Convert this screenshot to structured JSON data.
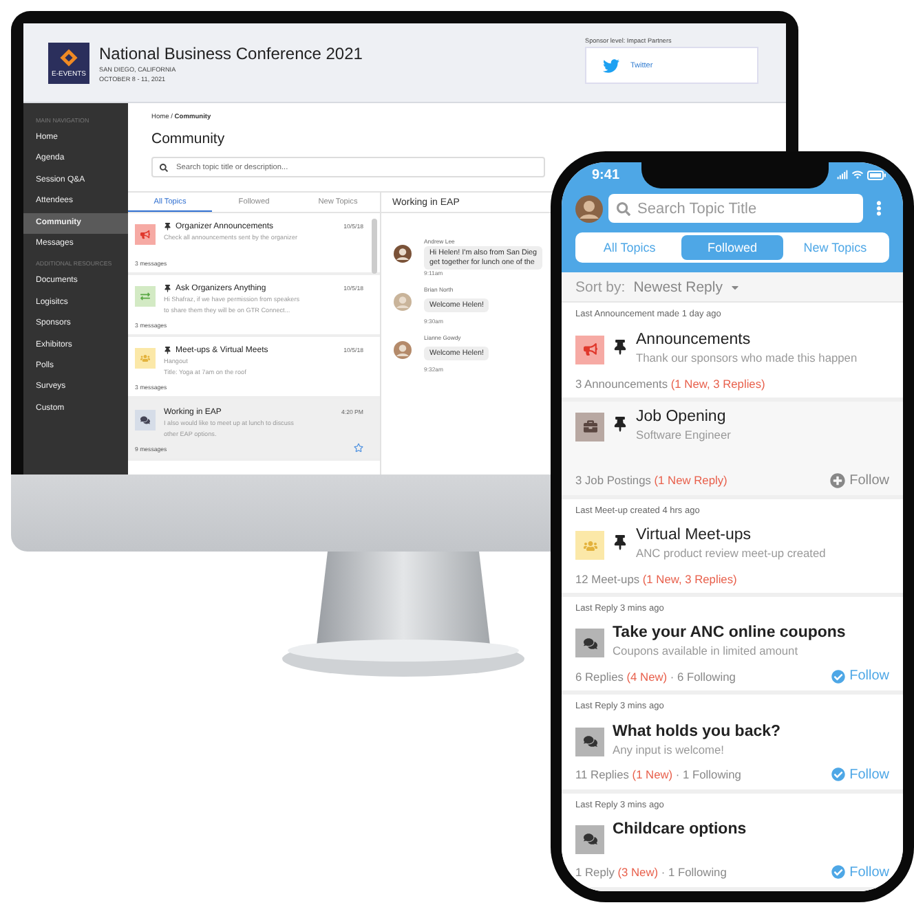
{
  "desktop": {
    "event": {
      "logo_text": "E-EVENTS",
      "title": "National Business Conference 2021",
      "location": "SAN DIEGO, CALIFORNIA",
      "dates": "OCTOBER 8 - 11, 2021"
    },
    "sponsor": {
      "label": "Sponsor level: Impact Partners",
      "name": "Twitter"
    },
    "sidebar": {
      "sections": [
        {
          "heading": "MAIN NAVIGATION",
          "items": [
            {
              "label": "Home",
              "selected": false
            },
            {
              "label": "Agenda",
              "selected": false
            },
            {
              "label": "Session Q&A",
              "selected": false
            },
            {
              "label": "Attendees",
              "selected": false
            },
            {
              "label": "Community",
              "selected": true
            },
            {
              "label": "Messages",
              "selected": false
            }
          ]
        },
        {
          "heading": "ADDITIONAL RESOURCES",
          "items": [
            {
              "label": "Documents",
              "selected": false
            },
            {
              "label": "Logisitcs",
              "selected": false
            },
            {
              "label": "Sponsors",
              "selected": false
            },
            {
              "label": "Exhibitors",
              "selected": false
            },
            {
              "label": "Polls",
              "selected": false
            },
            {
              "label": "Surveys",
              "selected": false
            },
            {
              "label": "Custom",
              "selected": false
            }
          ]
        }
      ]
    },
    "breadcrumb": "Home / **Community**",
    "page_title": "Community",
    "search": {
      "placeholder": "Search topic title or description..."
    },
    "tabs": [
      {
        "label": "All Topics",
        "selected": true
      },
      {
        "label": "Followed",
        "selected": false
      },
      {
        "label": "New Topics",
        "selected": false
      }
    ],
    "topics": [
      {
        "kind": "announcement",
        "pinned": true,
        "title": "Organizer Announcements",
        "preview": [
          "Check all announcements sent by the organizer"
        ],
        "date": "10/5/18",
        "count": "3 messages",
        "selected": false
      },
      {
        "kind": "question",
        "pinned": true,
        "title": "Ask Organizers Anything",
        "preview": [
          "Hi Shafraz, if we have permission from speakers",
          "to share them they will be on GTR Connect..."
        ],
        "date": "10/5/18",
        "count": "3 messages",
        "selected": false
      },
      {
        "kind": "meetup",
        "pinned": true,
        "title": "Meet-ups & Virtual Meets",
        "preview": [
          "Hangout",
          "Title: Yoga at 7am on the roof"
        ],
        "date": "10/5/18",
        "count": "3 messages",
        "selected": false
      },
      {
        "kind": "discussion",
        "pinned": false,
        "title": "Working in EAP",
        "preview": [
          "I also would like to meet up at lunch to discuss",
          "other EAP options."
        ],
        "date": "4:20 PM",
        "count": "9 messages",
        "selected": true,
        "starred": false
      }
    ],
    "conversation": {
      "title": "Working in EAP",
      "messages": [
        {
          "author": "Andrew Lee",
          "lines": [
            "Hi Helen! I'm also from San Dieg",
            "get together for lunch one of the"
          ],
          "time": "9:11am"
        },
        {
          "author": "Brian North",
          "lines": [
            "Welcome Helen!"
          ],
          "time": "9:30am"
        },
        {
          "author": "Lianne Gowdy",
          "lines": [
            "Welcome Helen!"
          ],
          "time": "9:32am"
        }
      ]
    }
  },
  "phone": {
    "status": {
      "time": "9:41"
    },
    "search": {
      "placeholder": "Search Topic Title"
    },
    "tabs": [
      {
        "label": "All Topics",
        "selected": false
      },
      {
        "label": "Followed",
        "selected": true
      },
      {
        "label": "New Topics",
        "selected": false
      }
    ],
    "sort": {
      "label": "Sort by:",
      "value": "Newest Reply"
    },
    "topics": [
      {
        "kind": "announcement",
        "pinned": true,
        "highlighted": false,
        "meta": "Last Announcement made 1 day ago",
        "title": "Announcements",
        "subtitle": "Thank our sponsors who made this happen",
        "count": "3 Announcements",
        "new": "(1 New, 3 Replies)"
      },
      {
        "kind": "job",
        "pinned": true,
        "highlighted": true,
        "title": "Job Opening",
        "subtitle": "Software Engineer",
        "count": "3 Job Postings",
        "new": "(1 New Reply)",
        "follow": {
          "label": "Follow",
          "followed": false
        }
      },
      {
        "kind": "meetup",
        "pinned": true,
        "highlighted": false,
        "meta": "Last Meet-up created 4 hrs ago",
        "title": "Virtual Meet-ups",
        "subtitle": "ANC product review meet-up created",
        "count": "12 Meet-ups",
        "new": "(1 New, 3 Replies)"
      },
      {
        "kind": "discussion",
        "pinned": false,
        "highlighted": false,
        "meta": "Last Reply 3 mins ago",
        "title": "Take your ANC online coupons",
        "subtitle": "Coupons available in limited amount",
        "count": "6 Replies",
        "new": "(4 New)",
        "following": "· 6 Following",
        "follow": {
          "label": "Follow",
          "followed": true
        }
      },
      {
        "kind": "discussion",
        "pinned": false,
        "highlighted": false,
        "meta": "Last Reply 3 mins ago",
        "title": "What holds you back?",
        "subtitle": "Any input is welcome!",
        "count": "11 Replies",
        "new": "(1 New)",
        "following": "· 1 Following",
        "follow": {
          "label": "Follow",
          "followed": true
        }
      },
      {
        "kind": "discussion",
        "pinned": false,
        "highlighted": false,
        "meta": "Last Reply 3 mins ago",
        "title": "Childcare options",
        "count": "1 Reply",
        "new": "(3 New)",
        "following": "· 1 Following",
        "follow": {
          "label": "Follow",
          "followed": true
        }
      }
    ]
  }
}
